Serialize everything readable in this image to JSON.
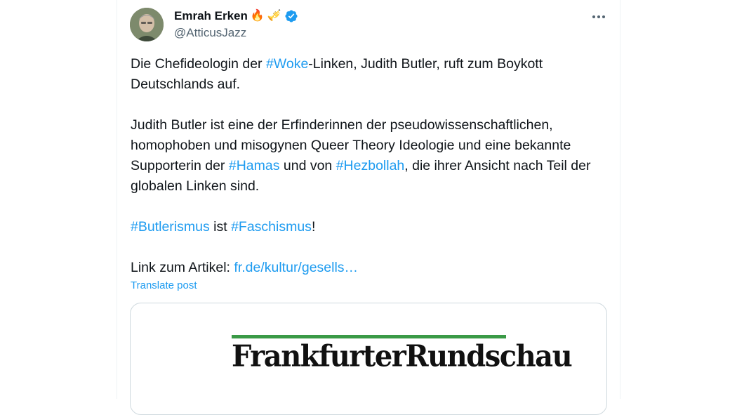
{
  "author": {
    "display_name": "Emrah Erken",
    "name_emojis": [
      "🔥",
      "🎺"
    ],
    "handle": "@AtticusJazz",
    "verified": true,
    "verified_color": "#1d9bf0"
  },
  "more_icon": "more-horizontal-icon",
  "tweet": {
    "p1": {
      "pre": "Die Chefideologin der ",
      "tag": "#Woke",
      "post": "-Linken, Judith Butler, ruft zum Boykott Deutschlands auf."
    },
    "p2": {
      "pre": "Judith Butler ist eine der Erfinderinnen der pseudowissenschaftlichen, homophoben und misogynen Queer Theory Ideologie und eine bekannte Supporterin der ",
      "tag1": "#Hamas",
      "mid": " und von ",
      "tag2": "#Hezbollah",
      "post": ", die ihrer Ansicht nach Teil der globalen Linken sind."
    },
    "p3": {
      "tag1": "#Butlerismus",
      "mid": " ist ",
      "tag2": "#Faschismus",
      "post": "!"
    },
    "p4": {
      "pre": "Link zum Artikel: ",
      "link": "fr.de/kultur/gesells…"
    }
  },
  "translate_label": "Translate post",
  "link_card": {
    "logo_text": "FrankfurterRundschau",
    "bar_color": "#3a9a46"
  },
  "colors": {
    "accent": "#1d9bf0",
    "text": "#0f1419",
    "secondary": "#536471"
  }
}
